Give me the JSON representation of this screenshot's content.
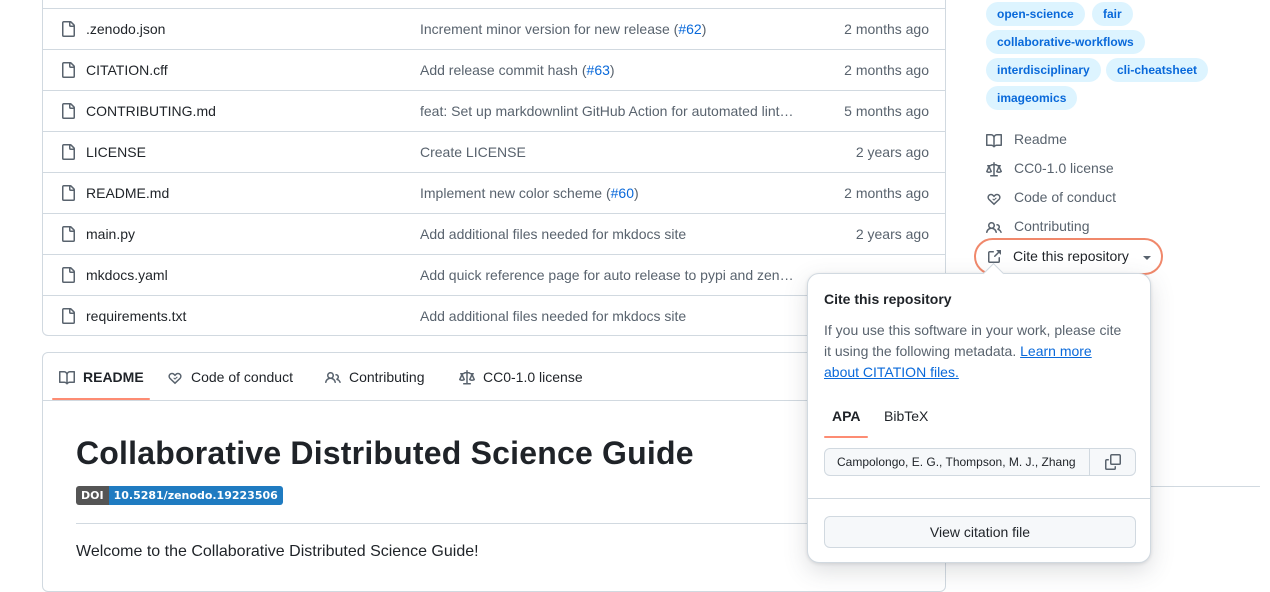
{
  "files": [
    {
      "name": ".zenodo.json",
      "commit_text": "Increment minor version for new release (",
      "commit_link": "#62",
      "commit_suffix": ")",
      "age": "2 months ago"
    },
    {
      "name": "CITATION.cff",
      "commit_text": "Add release commit hash (",
      "commit_link": "#63",
      "commit_suffix": ")",
      "age": "2 months ago"
    },
    {
      "name": "CONTRIBUTING.md",
      "commit_text": "feat: Set up markdownlint GitHub Action for automated lint…",
      "commit_link": "",
      "commit_suffix": "",
      "age": "5 months ago"
    },
    {
      "name": "LICENSE",
      "commit_text": "Create LICENSE",
      "commit_link": "",
      "commit_suffix": "",
      "age": "2 years ago"
    },
    {
      "name": "README.md",
      "commit_text": "Implement new color scheme (",
      "commit_link": "#60",
      "commit_suffix": ")",
      "age": "2 months ago"
    },
    {
      "name": "main.py",
      "commit_text": "Add additional files needed for mkdocs site",
      "commit_link": "",
      "commit_suffix": "",
      "age": "2 years ago"
    },
    {
      "name": "mkdocs.yaml",
      "commit_text": "Add quick reference page for auto release to pypi and zen…",
      "commit_link": "",
      "commit_suffix": "",
      "age": ""
    },
    {
      "name": "requirements.txt",
      "commit_text": "Add additional files needed for mkdocs site",
      "commit_link": "",
      "commit_suffix": "",
      "age": ""
    }
  ],
  "readme": {
    "tabs": [
      "README",
      "Code of conduct",
      "Contributing",
      "CC0-1.0 license"
    ],
    "title": "Collaborative Distributed Science Guide",
    "doi_label": "DOI",
    "doi_value": "10.5281/zenodo.19223506",
    "welcome": "Welcome to the Collaborative Distributed Science Guide!"
  },
  "sidebar": {
    "topics": [
      "open-science",
      "fair",
      "collaborative-workflows",
      "interdisciplinary",
      "cli-cheatsheet",
      "imageomics"
    ],
    "links": [
      "Readme",
      "CC0-1.0 license",
      "Code of conduct",
      "Contributing"
    ],
    "cite_label": "Cite this repository"
  },
  "cite_popover": {
    "title": "Cite this repository",
    "description": "If you use this software in your work, please cite it using the following metadata.",
    "learn_more": "Learn more about CITATION files.",
    "tabs": [
      "APA",
      "BibTeX"
    ],
    "citation_text": "Campolongo, E. G., Thompson, M. J., Zhang",
    "view_button": "View citation file"
  },
  "colors": {
    "accent_orange": "#fd8c73",
    "highlight_ring": "#f0886b",
    "topic_bg": "#ddf4ff",
    "link_blue": "#0969da"
  }
}
